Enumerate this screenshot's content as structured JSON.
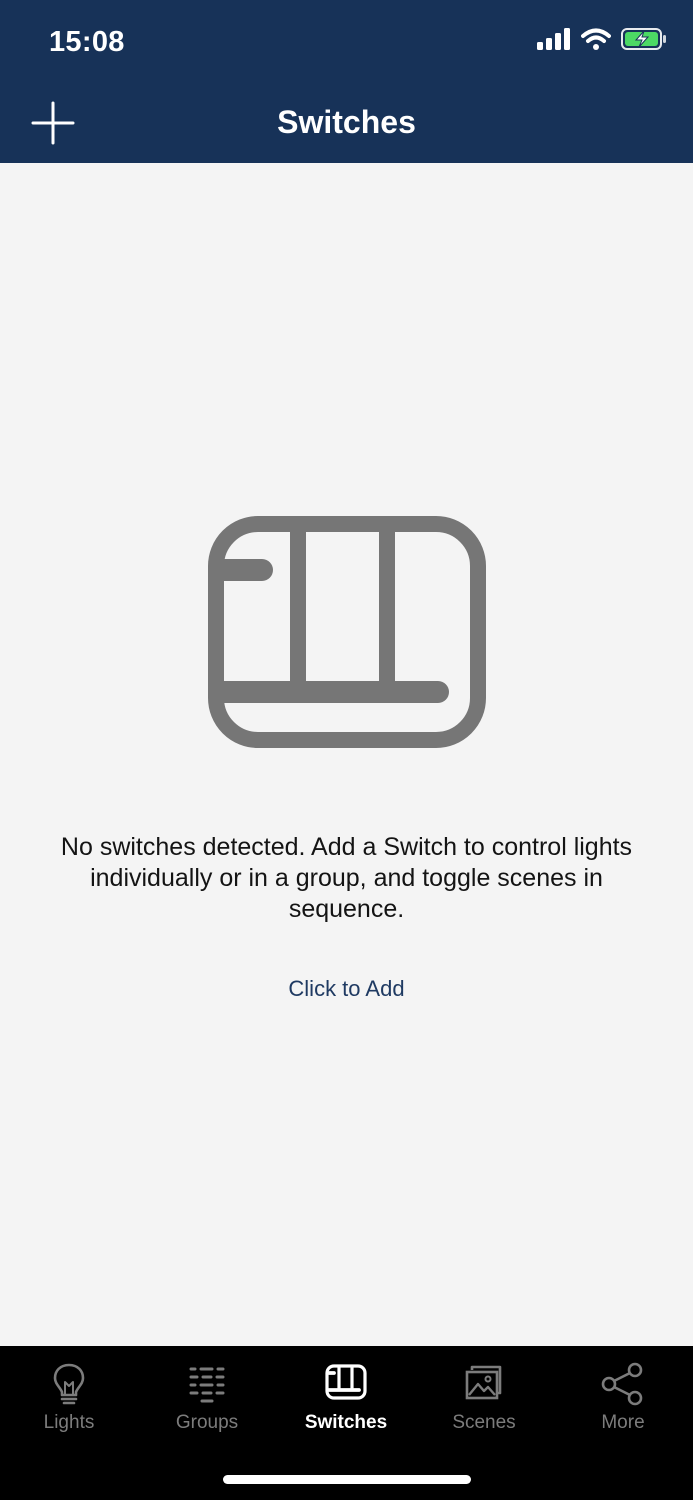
{
  "status_bar": {
    "time": "15:08",
    "icons": [
      "signal-icon",
      "wifi-icon",
      "battery-charging-icon"
    ]
  },
  "nav": {
    "title": "Switches",
    "add_icon": "plus-icon"
  },
  "empty_state": {
    "icon": "switch-icon",
    "message": "No switches detected. Add a Switch to control lights individually or in a group, and toggle scenes in sequence.",
    "action_label": "Click to Add"
  },
  "tabs": [
    {
      "label": "Lights",
      "icon": "lightbulb-icon",
      "active": false
    },
    {
      "label": "Groups",
      "icon": "groups-icon",
      "active": false
    },
    {
      "label": "Switches",
      "icon": "switch-icon",
      "active": true
    },
    {
      "label": "Scenes",
      "icon": "scenes-icon",
      "active": false
    },
    {
      "label": "More",
      "icon": "share-icon",
      "active": false
    }
  ],
  "colors": {
    "header_background": "#173258",
    "content_background": "#f4f4f4",
    "tabbar_background": "#000000",
    "accent_link": "#1f3a62",
    "illustration": "#767676",
    "tab_inactive": "#7c7c7c",
    "tab_active": "#ffffff",
    "battery_green": "#4cd964"
  }
}
